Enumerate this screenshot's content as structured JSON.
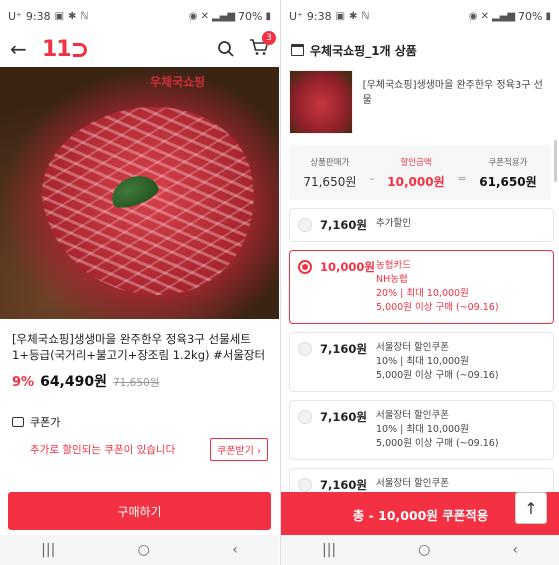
{
  "status_left": {
    "carrier": "U⁺",
    "time": "9:38",
    "battery": "70%"
  },
  "left": {
    "logo": "11",
    "cart_count": "3",
    "image_overlay_text": "우체국쇼핑",
    "title": "[우체국쇼핑]생생마을 완주한우 정육3구 선물세트 1+등급(국거리+불고기+장조림 1.2kg) #서울장터",
    "discount": "9%",
    "price": "64,490원",
    "original_price": "71,650원",
    "coupon_label": "쿠폰가",
    "coupon_msg": "추가로 할인되는 쿠폰이 있습니다",
    "coupon_btn": "쿠폰받기 ›",
    "buy_btn": "구매하기"
  },
  "right": {
    "header": "우체국쇼핑_1개 상품",
    "product_name": "[우체국쇼핑]생생마을 완주한우 정육3구 선물",
    "summary": {
      "price_label": "상품판매가",
      "price": "71,650원",
      "discount_label": "할인금액",
      "discount": "10,000원",
      "coupon_price_label": "쿠폰적용가",
      "coupon_price": "61,650원",
      "minus": "–",
      "equals": "="
    },
    "options": [
      {
        "amount": "7,160원",
        "lines": [
          "추가할인"
        ],
        "selected": false
      },
      {
        "amount": "10,000원",
        "lines": [
          "농협카드",
          "NH농협",
          "20% | 최대 10,000원",
          "5,000원 이상 구매 (~09.16)"
        ],
        "selected": true
      },
      {
        "amount": "7,160원",
        "lines": [
          "서울장터 할인쿠폰",
          "10% | 최대 10,000원",
          "5,000원 이상 구매 (~09.16)"
        ],
        "selected": false
      },
      {
        "amount": "7,160원",
        "lines": [
          "서울장터 할인쿠폰",
          "10% | 최대 10,000원",
          "5,000원 이상 구매 (~09.16)"
        ],
        "selected": false
      },
      {
        "amount": "7,160원",
        "lines": [
          "서울장터 할인쿠폰"
        ],
        "selected": false
      }
    ],
    "apply_btn": "총 - 10,000원 쿠폰적용",
    "top_btn": "↑"
  },
  "nav": {
    "recent": "|||",
    "home": "○",
    "back": "‹"
  }
}
